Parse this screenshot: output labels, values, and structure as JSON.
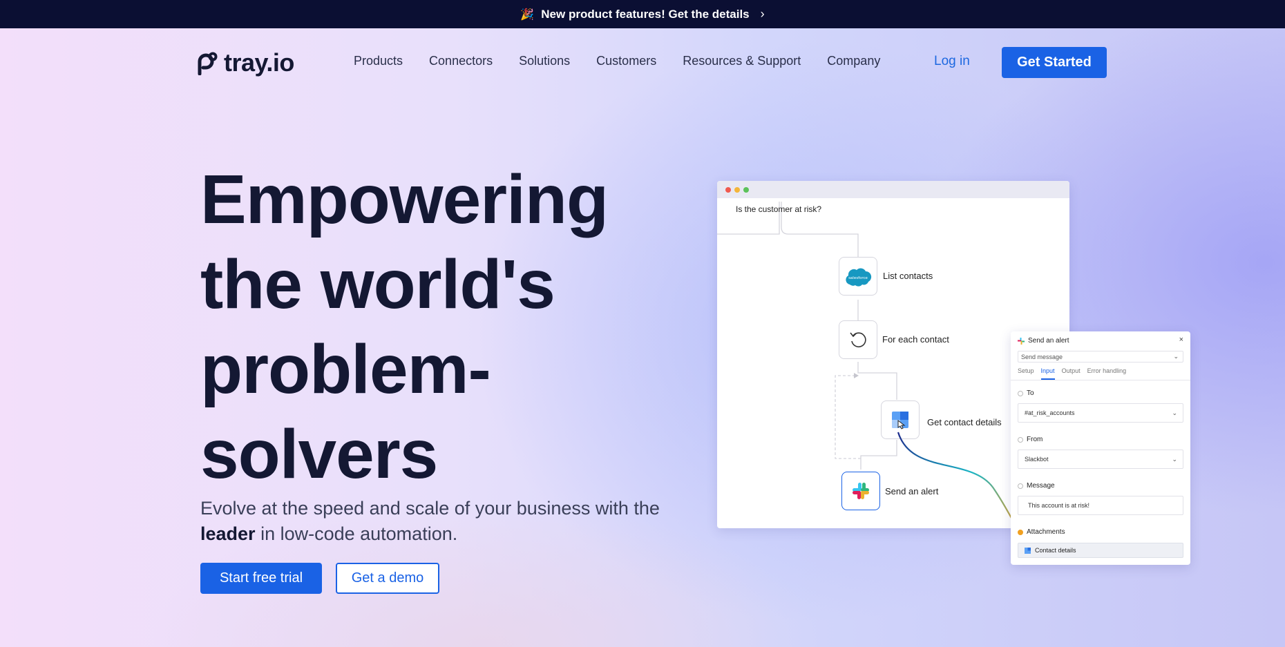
{
  "announcement": {
    "icon": "party-popper-icon",
    "text": "New product features! Get the details",
    "chevron": "›"
  },
  "header": {
    "logo_text": "tray.io",
    "nav": [
      {
        "label": "Products"
      },
      {
        "label": "Connectors"
      },
      {
        "label": "Solutions"
      },
      {
        "label": "Customers"
      },
      {
        "label": "Resources & Support"
      },
      {
        "label": "Company"
      }
    ],
    "login_label": "Log in",
    "get_started_label": "Get Started"
  },
  "hero": {
    "title_lines": [
      "Empowering",
      "the world's",
      "problem-",
      "solvers"
    ],
    "subtitle_prefix": "Evolve at the speed and scale of your business with the",
    "subtitle_bold": "leader",
    "subtitle_suffix": " in low-code automation.",
    "primary_cta": "Start free trial",
    "secondary_cta": "Get a demo"
  },
  "workflow": {
    "question": "Is the customer at risk?",
    "steps": [
      {
        "label": "List contacts",
        "icon": "salesforce-icon",
        "icon_text": "salesforce"
      },
      {
        "label": "For each contact",
        "icon": "loop-icon"
      },
      {
        "label": "Get contact details",
        "icon": "document-icon"
      },
      {
        "label": "Send an alert",
        "icon": "slack-icon"
      }
    ]
  },
  "panel": {
    "title": "Send an alert",
    "close": "×",
    "operation": "Send message",
    "tabs": [
      "Setup",
      "Input",
      "Output",
      "Error handling"
    ],
    "active_tab": "Input",
    "fields": {
      "to_label": "To",
      "to_value": "#at_risk_accounts",
      "from_label": "From",
      "from_value": "Slackbot",
      "message_label": "Message",
      "message_value": "This account is at risk!",
      "attachments_label": "Attachments",
      "attachment_value": "Contact details"
    }
  },
  "colors": {
    "brand_blue": "#1a62e5",
    "announcement_bg": "#0b0f33",
    "heading": "#141833"
  }
}
